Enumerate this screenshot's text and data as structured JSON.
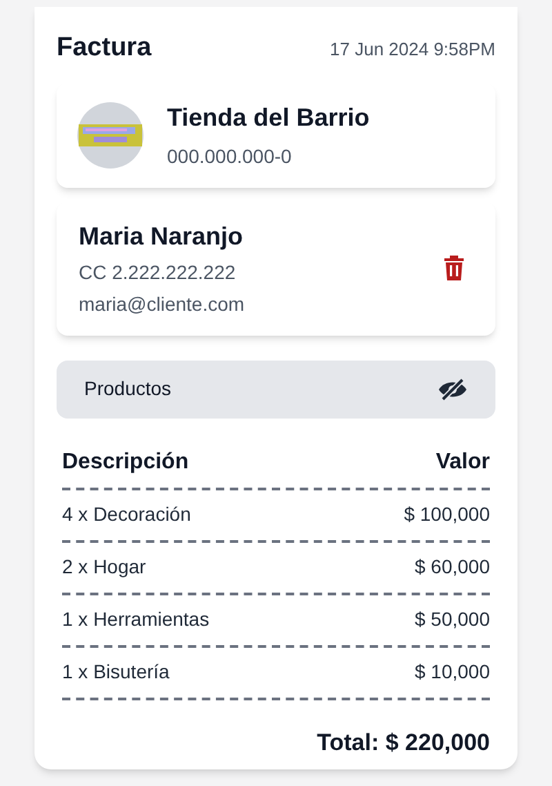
{
  "header": {
    "title": "Factura",
    "date": "17 Jun 2024 9:58PM"
  },
  "store": {
    "name": "Tienda del Barrio",
    "tax_id": "000.000.000-0"
  },
  "customer": {
    "name": "Maria Naranjo",
    "id_document": "CC 2.222.222.222",
    "email": "maria@cliente.com"
  },
  "products_section": {
    "label": "Productos",
    "hidden": true
  },
  "table": {
    "columns": [
      "Descripción",
      "Valor"
    ],
    "rows": [
      {
        "description": "4 x Decoración",
        "value": "$ 100,000"
      },
      {
        "description": "2 x Hogar",
        "value": "$ 60,000"
      },
      {
        "description": "1 x Herramientas",
        "value": "$ 50,000"
      },
      {
        "description": "1 x Bisutería",
        "value": "$ 10,000"
      }
    ]
  },
  "total": "Total: $ 220,000"
}
